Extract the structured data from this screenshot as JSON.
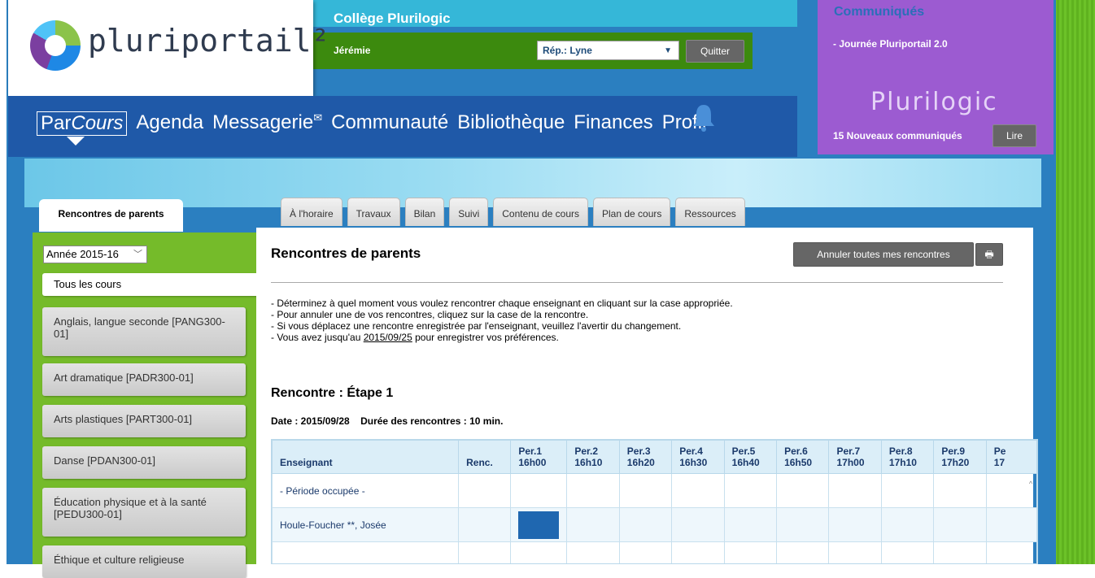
{
  "header": {
    "logo_text": "pluriportail²",
    "school_name": "Collège Plurilogic",
    "user_name": "Jérémie",
    "rep_select": "Rép.: Lyne",
    "quit_label": "Quitter"
  },
  "nav": {
    "items": [
      "Agenda",
      "Messagerie",
      "Communauté",
      "Bibliothèque",
      "Finances",
      "Profil"
    ],
    "parcours_par": "Par",
    "parcours_cours": "Cours"
  },
  "communiques": {
    "title": "Communiqués",
    "item": "- Journée Pluriportail 2.0",
    "brand": "Plurilogic",
    "count_text": "15 Nouveaux communiqués",
    "read_label": "Lire"
  },
  "sidebar": {
    "tab_label": "Rencontres de parents",
    "year": "Année 2015-16",
    "all_courses": "Tous les cours",
    "courses": [
      "Anglais, langue seconde [PANG300-01]",
      "Art dramatique [PADR300-01]",
      "Arts plastiques [PART300-01]",
      "Danse [PDAN300-01]",
      "Éducation physique et à la santé [PEDU300-01]",
      "Éthique et culture religieuse"
    ]
  },
  "tabs": [
    "À l'horaire",
    "Travaux",
    "Bilan",
    "Suivi",
    "Contenu de cours",
    "Plan de cours",
    "Ressources"
  ],
  "main": {
    "title": "Rencontres de parents",
    "cancel_all": "Annuler toutes mes rencontres",
    "instructions": [
      "- Déterminez à quel moment vous voulez rencontrer chaque enseignant en cliquant sur la case appropriée.",
      "- Pour annuler une de vos rencontres, cliquez sur la case de la rencontre.",
      "- Si vous déplacez une rencontre enregistrée par l'enseignant, veuillez l'avertir du changement."
    ],
    "deadline_prefix": "- Vous avez jusqu'au ",
    "deadline_date": "2015/09/25",
    "deadline_suffix": " pour enregistrer vos préférences.",
    "rencontre_title": "Rencontre : Étape 1",
    "date_line": "Date : 2015/09/28    Durée des rencontres : 10 min."
  },
  "table": {
    "col_teacher": "Enseignant",
    "col_renc": "Renc.",
    "periods": [
      {
        "per": "Per.1",
        "time": "16h00"
      },
      {
        "per": "Per.2",
        "time": "16h10"
      },
      {
        "per": "Per.3",
        "time": "16h20"
      },
      {
        "per": "Per.4",
        "time": "16h30"
      },
      {
        "per": "Per.5",
        "time": "16h40"
      },
      {
        "per": "Per.6",
        "time": "16h50"
      },
      {
        "per": "Per.7",
        "time": "17h00"
      },
      {
        "per": "Per.8",
        "time": "17h10"
      },
      {
        "per": "Per.9",
        "time": "17h20"
      },
      {
        "per": "Pe",
        "time": "17"
      }
    ],
    "rows": [
      {
        "teacher": "- Période occupée -",
        "renc": "",
        "filled": []
      },
      {
        "teacher": "Houle-Foucher **, Josée",
        "renc": "",
        "filled": [
          0
        ]
      }
    ]
  }
}
